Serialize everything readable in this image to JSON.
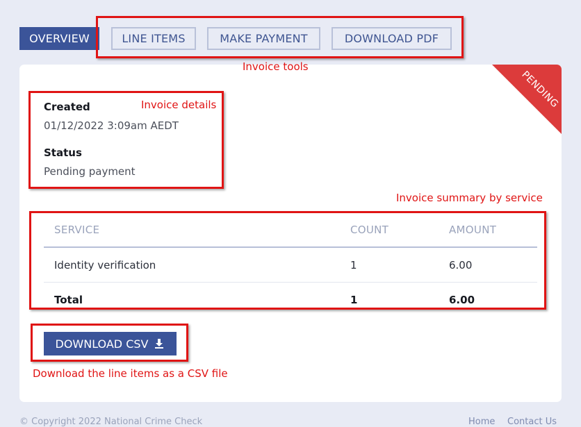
{
  "tabs": [
    {
      "label": "OVERVIEW",
      "active": true
    },
    {
      "label": "LINE ITEMS",
      "active": false
    },
    {
      "label": "MAKE PAYMENT",
      "active": false
    },
    {
      "label": "DOWNLOAD PDF",
      "active": false
    }
  ],
  "ribbon": {
    "text": "PENDING",
    "color": "#dc3b3b"
  },
  "details": {
    "created_label": "Created",
    "created_value": "01/12/2022 3:09am AEDT",
    "status_label": "Status",
    "status_value": "Pending payment"
  },
  "table": {
    "headers": [
      "SERVICE",
      "COUNT",
      "AMOUNT"
    ],
    "rows": [
      {
        "service": "Identity verification",
        "count": "1",
        "amount": "6.00"
      }
    ],
    "total": {
      "label": "Total",
      "count": "1",
      "amount": "6.00"
    }
  },
  "csv_button": {
    "label": "DOWNLOAD CSV",
    "icon": "download-icon"
  },
  "annotations": {
    "invoice_tools": "Invoice tools",
    "invoice_details": "Invoice details",
    "summary": "Invoice summary by service",
    "download_note": "Download the line items as a CSV file"
  },
  "footer": {
    "copyright": "© Copyright 2022 National Crime Check",
    "links": [
      "Home",
      "Contact Us"
    ]
  },
  "colors": {
    "accent": "#3b5499",
    "annotation": "#e01414",
    "background": "#e8ebf5"
  }
}
